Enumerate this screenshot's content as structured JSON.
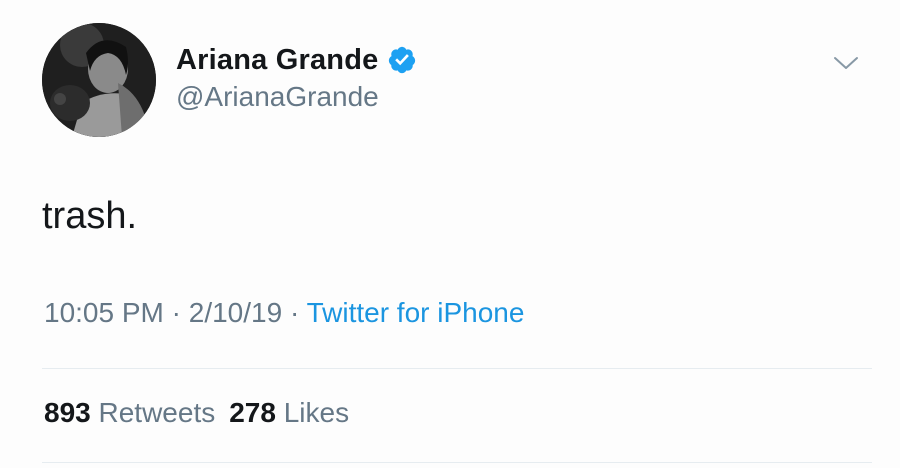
{
  "author": {
    "display_name": "Ariana Grande",
    "handle": "@ArianaGrande",
    "verified_icon": "verified-badge-icon",
    "avatar_icon": "profile-avatar"
  },
  "tweet": {
    "text": "trash.",
    "time": "10:05 PM",
    "separator_1": " · ",
    "date": "2/10/19",
    "separator_2": " · ",
    "source": "Twitter for iPhone"
  },
  "stats": {
    "retweets_count": "893",
    "retweets_label": "Retweets",
    "likes_count": "278",
    "likes_label": "Likes"
  },
  "colors": {
    "verified": "#1da1f2",
    "link": "#1b95e0",
    "secondary_text": "#657786",
    "primary_text": "#14171a"
  }
}
